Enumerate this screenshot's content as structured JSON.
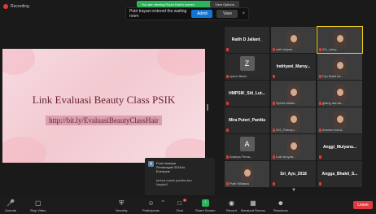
{
  "recording": {
    "label": "Recording",
    "color": "#e0393e"
  },
  "share_banner": {
    "text": "You are viewing Room Host's screen",
    "options_label": "View Options"
  },
  "notification": {
    "message": "Putri trayani entered the waiting room",
    "admit_label": "Admit",
    "view_label": "View",
    "close_icon": "×"
  },
  "slide": {
    "title": "Link Evaluasi Beauty Class PSIK",
    "link": "http://bit.ly/EvaluasiBeautyClassHair"
  },
  "gallery": {
    "tiles": [
      {
        "name": "Ratih D Jaliant_",
        "kind": "center"
      },
      {
        "name": "sofi melyan..",
        "kind": "pink-photo"
      },
      {
        "name": "AD_Lainy..",
        "kind": "pink-photo"
      },
      {
        "name": "zyunn fkech",
        "kind": "avatar",
        "initial": "Z"
      },
      {
        "name": "Indriyani_Marsy...",
        "kind": "center"
      },
      {
        "name": "Fyo Rakti ha...",
        "kind": "photo"
      },
      {
        "name": "HMPSIK_Siti_Lut...",
        "kind": "center"
      },
      {
        "name": "Syrina Maidu..",
        "kind": "pink-photo"
      },
      {
        "name": "gilang darma...",
        "kind": "photo"
      },
      {
        "name": "Mira Puteri_Panitia",
        "kind": "center"
      },
      {
        "name": "002_Rahayu...",
        "kind": "photo"
      },
      {
        "name": "Ammia brand..",
        "kind": "photo"
      },
      {
        "name": "Anaeya Firma...",
        "kind": "avatar",
        "initial": "A"
      },
      {
        "name": "Luth Arsyda...",
        "kind": "photo"
      },
      {
        "name": "Anggi_Mulyana...",
        "kind": "center"
      },
      {
        "name": "Putri Wildana",
        "kind": "photo"
      },
      {
        "name": "Sri_Ayu_2018",
        "kind": "center"
      },
      {
        "name": "Angga_Bhakti_S...",
        "kind": "center"
      }
    ]
  },
  "chat": {
    "avatar_initial": "A",
    "from_line1": "From Anaeya",
    "from_line2": "Firmansyah 2018 to",
    "from_line3": "Everyone",
    "message_line1": "terima masih panitia dan",
    "message_line2": "Narjab!!"
  },
  "toolbar": {
    "unmute": "Unmute",
    "stop_video": "Stop Video",
    "security": "Security",
    "participants": "Participants",
    "participants_count": "41",
    "chat": "Chat",
    "chat_badge": "1",
    "share_screen": "Share Screen",
    "record": "Record",
    "breakout": "Breakout Rooms",
    "reactions": "Reactions",
    "leave": "Leave"
  }
}
